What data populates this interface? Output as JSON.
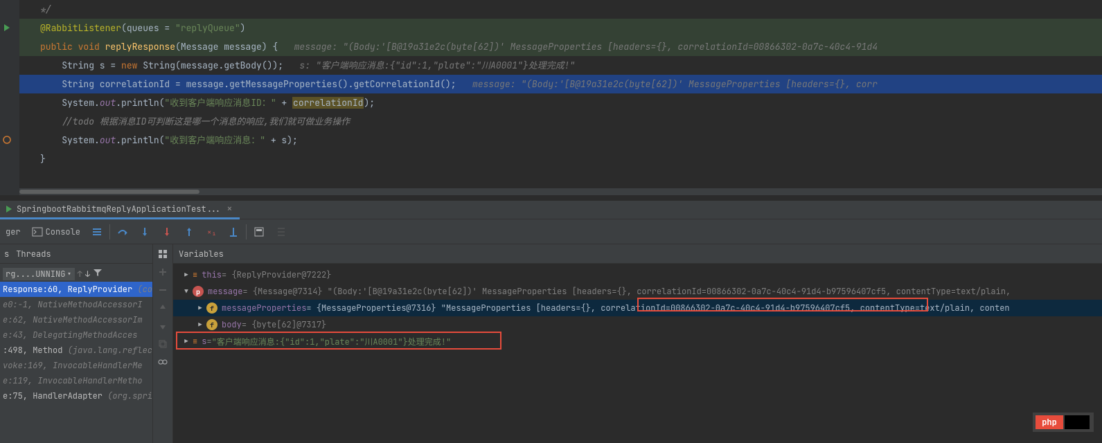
{
  "code": {
    "comment_end": "*/",
    "annotation": "@RabbitListener",
    "annotation_args": "(queues = \"replyQueue\")",
    "sig_pre": "public void ",
    "sig_name": "replyResponse",
    "sig_args": "(Message message) {   ",
    "sig_hint": "message: \"(Body:'[B@19a31e2c(byte[62])' MessageProperties [headers={}, correlationId=00866302-0a7c-40c4-91d4",
    "l1a": "String s = ",
    "l1b": "new ",
    "l1c": "String(message.getBody());   ",
    "l1hint": "s: \"客户端响应消息:{\"id\":1,\"plate\":\"川A0001\"}处理完成!\"",
    "l2a": "String correlationId = message.getMessageProperties().getCorrelationId();   ",
    "l2hint": "message: \"(Body:'[B@19a31e2c(byte[62])' MessageProperties [headers={}, corr",
    "l3a": "System.",
    "l3b": "out",
    "l3c": ".println(",
    "l3str": "\"收到客户端响应消息ID：\"",
    "l3d": " + ",
    "l3sel": "correlationId",
    "l3e": ");",
    "l4": "//todo 根据消息ID可判断这是哪一个消息的响应,我们就可做业务操作",
    "l5a": "System.",
    "l5b": "out",
    "l5c": ".println(",
    "l5str": "\"收到客户端响应消息：\"",
    "l5d": " + s);",
    "brace": "}"
  },
  "tab": {
    "title": "SpringbootRabbitmqReplyApplicationTest..."
  },
  "toolbar": {
    "debugger_suffix": "ger",
    "console": "Console",
    "frames": "s",
    "threads": "Threads",
    "variables": "Variables"
  },
  "frames": {
    "thread_label": "rg....UNNING",
    "rows": [
      {
        "t": "Response:60, ReplyProvider ",
        "g": "(co",
        "sel": true
      },
      {
        "t": "e0:-1, NativeMethodAccessorI",
        "g": "",
        "sel": false,
        "grey": true
      },
      {
        "t": "e:62, NativeMethodAccessorIm",
        "g": "",
        "sel": false,
        "grey": true
      },
      {
        "t": "e:43, DelegatingMethodAcces",
        "g": "",
        "sel": false,
        "grey": true
      },
      {
        "t": ":498, Method ",
        "g": "(java.lang.reflec",
        "sel": false
      },
      {
        "t": "voke:169, InvocableHandlerMe",
        "g": "",
        "sel": false,
        "grey": true
      },
      {
        "t": "e:119, InvocableHandlerMetho",
        "g": "",
        "sel": false,
        "grey": true
      },
      {
        "t": "e:75, HandlerAdapter ",
        "g": "(org.spri",
        "sel": false
      }
    ]
  },
  "vars": {
    "this": {
      "name": "this",
      "val": " = {ReplyProvider@7222}"
    },
    "message": {
      "name": "message",
      "val": " = {Message@7314} \"(Body:'[B@19a31e2c(byte[62])' MessageProperties [headers={}, correlationId=00866302-0a7c-40c4-91d4-b97596407cf5, contentType=text/plain,"
    },
    "mp": {
      "name": "messageProperties",
      "val": " = {MessageProperties@7316} \"MessageProperties [headers={}, correlationId=00866302-0a7c-40c4-91d4-b97596407cf5, contentType=text/plain, conten"
    },
    "body": {
      "name": "body",
      "val": " = {byte[62]@7317}"
    },
    "s": {
      "name": "s",
      "pre": " = ",
      "str": "\"客户端响应消息:{\"id\":1,\"plate\":\"川A0001\"}处理完成!\""
    }
  },
  "watermark": "php"
}
